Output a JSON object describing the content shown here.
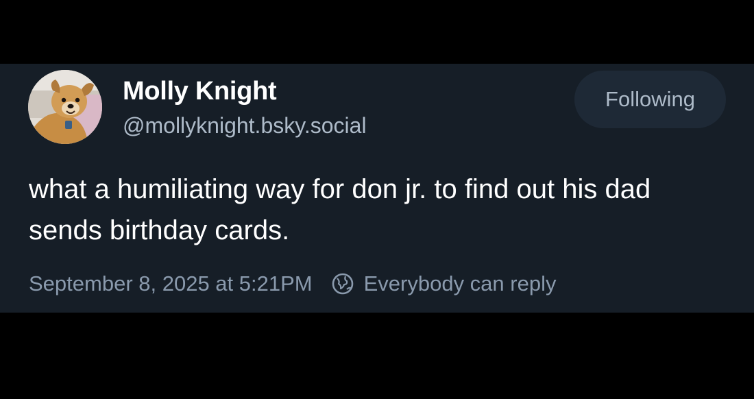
{
  "post": {
    "author": {
      "display_name": "Molly Knight",
      "handle": "@mollyknight.bsky.social",
      "avatar_icon": "dog-avatar"
    },
    "follow_button_label": "Following",
    "text": "what a humiliating way for don jr. to find out his dad sends birthday cards.",
    "timestamp": "September 8, 2025 at 5:21PM",
    "reply_setting": {
      "icon": "globe-icon",
      "label": "Everybody can reply"
    }
  },
  "colors": {
    "page_background": "#000000",
    "card_background": "#161e27",
    "primary_text": "#ffffff",
    "secondary_text": "#aebbc9",
    "muted_text": "#8a9aad",
    "button_background": "#1e2936"
  }
}
